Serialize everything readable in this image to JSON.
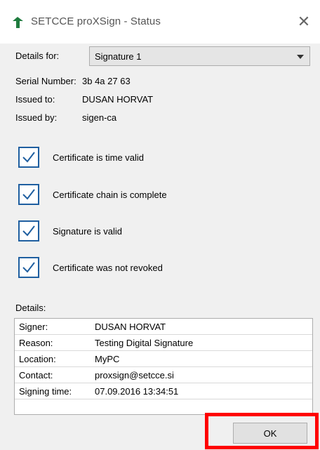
{
  "window": {
    "title": "SETCCE proXSign - Status",
    "close_glyph": "✕"
  },
  "header": {
    "details_for_label": "Details for:",
    "selected_signature": "Signature 1",
    "serial_label": "Serial Number:",
    "serial_value": "3b 4a 27 63",
    "issued_to_label": "Issued to:",
    "issued_to_value": "DUSAN HORVAT",
    "issued_by_label": "Issued by:",
    "issued_by_value": "sigen-ca"
  },
  "checks": [
    {
      "label": "Certificate is time valid",
      "checked": true
    },
    {
      "label": "Certificate chain is complete",
      "checked": true
    },
    {
      "label": "Signature is valid",
      "checked": true
    },
    {
      "label": "Certificate was not revoked",
      "checked": true
    }
  ],
  "details": {
    "heading": "Details:",
    "rows": [
      {
        "label": "Signer:",
        "value": "DUSAN HORVAT"
      },
      {
        "label": "Reason:",
        "value": "Testing Digital Signature"
      },
      {
        "label": "Location:",
        "value": "MyPC"
      },
      {
        "label": "Contact:",
        "value": "proxsign@setcce.si"
      },
      {
        "label": "Signing time:",
        "value": "07.09.2016 13:34:51"
      }
    ]
  },
  "buttons": {
    "ok_label": "OK"
  },
  "colors": {
    "checkbox_border": "#1f5fa0",
    "highlight": "#ff0000",
    "app_icon": "#1e7b3e"
  }
}
